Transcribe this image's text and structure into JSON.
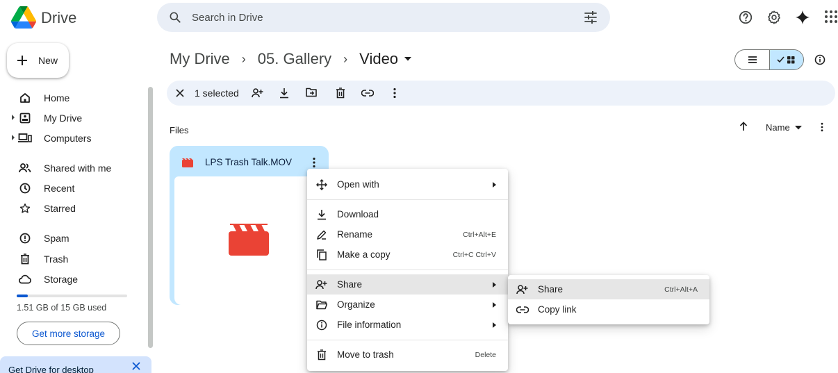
{
  "header": {
    "app_name": "Drive",
    "search_placeholder": "Search in Drive",
    "icons": [
      "help-icon",
      "settings-icon",
      "gemini-icon",
      "apps-icon"
    ]
  },
  "sidebar": {
    "new_label": "New",
    "items": [
      {
        "label": "Home",
        "icon": "home-icon"
      },
      {
        "label": "My Drive",
        "icon": "my-drive-icon"
      },
      {
        "label": "Computers",
        "icon": "computers-icon"
      },
      {
        "label": "Shared with me",
        "icon": "shared-icon"
      },
      {
        "label": "Recent",
        "icon": "clock-icon"
      },
      {
        "label": "Starred",
        "icon": "star-icon"
      },
      {
        "label": "Spam",
        "icon": "spam-icon"
      },
      {
        "label": "Trash",
        "icon": "trash-icon"
      },
      {
        "label": "Storage",
        "icon": "cloud-icon"
      }
    ],
    "storage_used_fraction": 0.1,
    "storage_text": "1.51 GB of 15 GB used",
    "get_storage_label": "Get more storage",
    "promo_text": "Get Drive for desktop"
  },
  "main": {
    "breadcrumb": [
      "My Drive",
      "05. Gallery",
      "Video"
    ],
    "selection_text": "1 selected",
    "files_label": "Files",
    "sort_label": "Name",
    "file": {
      "name": "LPS Trash Talk.MOV"
    }
  },
  "context_menu": {
    "items": [
      {
        "label": "Open with",
        "shortcut": ""
      },
      {
        "label": "Download",
        "shortcut": ""
      },
      {
        "label": "Rename",
        "shortcut": "Ctrl+Alt+E"
      },
      {
        "label": "Make a copy",
        "shortcut": "Ctrl+C Ctrl+V"
      },
      {
        "label": "Share",
        "shortcut": ""
      },
      {
        "label": "Organize",
        "shortcut": ""
      },
      {
        "label": "File information",
        "shortcut": ""
      },
      {
        "label": "Move to trash",
        "shortcut": "Delete"
      }
    ]
  },
  "share_submenu": {
    "items": [
      {
        "label": "Share",
        "shortcut": "Ctrl+Alt+A"
      },
      {
        "label": "Copy link",
        "shortcut": ""
      }
    ]
  },
  "colors": {
    "accent_blue": "#0b57d0",
    "selected_card": "#c2e7ff",
    "video_red": "#ea4335",
    "search_bg": "#e9eef6"
  }
}
